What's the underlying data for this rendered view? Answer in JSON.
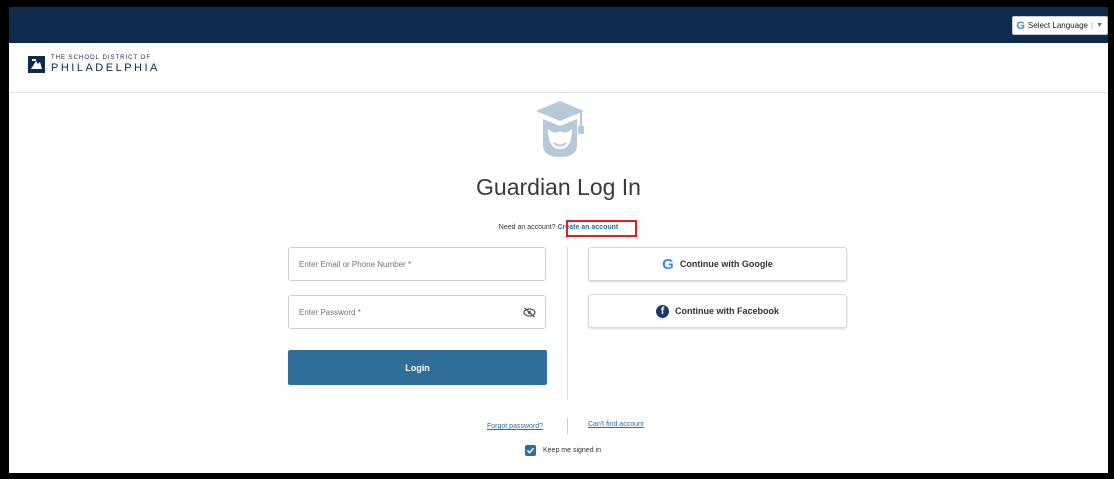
{
  "top_bar": {
    "language_selector": {
      "label": "Select Language",
      "icon": "google-g-icon"
    }
  },
  "header": {
    "logo_small": "THE SCHOOL DISTRICT OF",
    "logo_big": "PHILADELPHIA",
    "logo_icon": "school-district-logo-icon"
  },
  "main": {
    "hero_icon": "graduation-cap-student-icon",
    "title": "Guardian Log In",
    "need_account_text": "Need an account?",
    "create_account_link": "Create an account",
    "email_placeholder": "Enter Email or Phone Number *",
    "password_placeholder": "Enter Password *",
    "login_label": "Login",
    "google_label": "Continue with Google",
    "facebook_label": "Continue with Facebook",
    "forgot_password": "Forgot password?",
    "cant_find_account": "Can't find account",
    "keep_signed_in": "Keep me signed in",
    "keep_signed_in_checked": true
  },
  "colors": {
    "top_bar": "#0e2a4d",
    "button": "#2e6e99",
    "link": "#2a6ea8",
    "highlight_box": "#e02020"
  }
}
